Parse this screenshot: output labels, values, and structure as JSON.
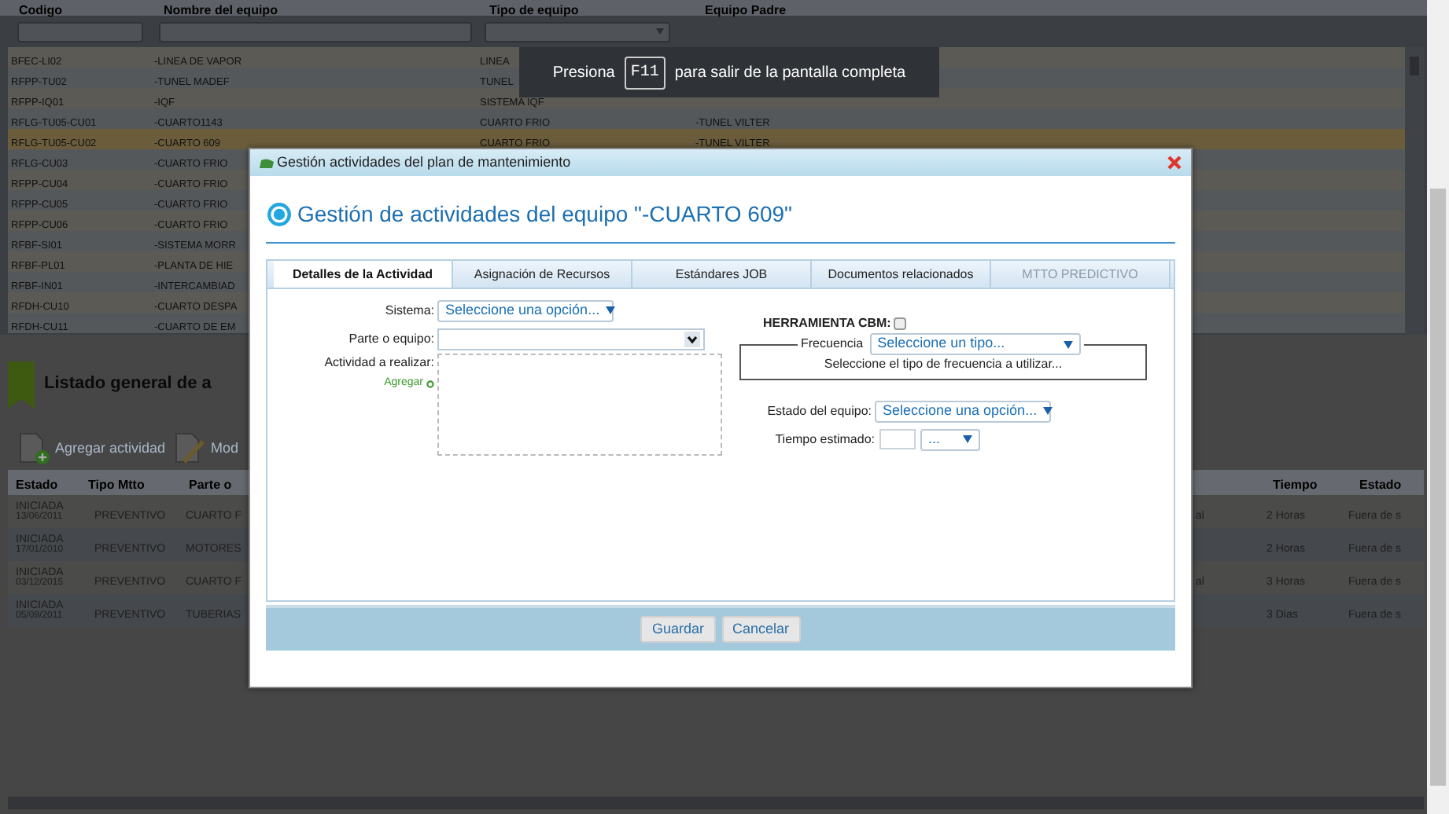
{
  "grid": {
    "columns": [
      "Codigo",
      "Nombre del equipo",
      "Tipo de equipo",
      "Equipo Padre"
    ],
    "rows": [
      {
        "cells": [
          "BFEC-LI02",
          "-LINEA DE VAPOR",
          "LINEA",
          ""
        ],
        "selected": false
      },
      {
        "cells": [
          "RFPP-TU02",
          "-TUNEL MADEF",
          "TUNEL",
          ""
        ],
        "selected": false
      },
      {
        "cells": [
          "RFPP-IQ01",
          "-IQF",
          "SISTEMA IQF",
          ""
        ],
        "selected": false
      },
      {
        "cells": [
          "RFLG-TU05-CU01",
          "-CUARTO1143",
          "CUARTO FRIO",
          "-TUNEL VILTER"
        ],
        "selected": false
      },
      {
        "cells": [
          "RFLG-TU05-CU02",
          "-CUARTO 609",
          "CUARTO FRIO",
          "-TUNEL VILTER"
        ],
        "selected": true
      },
      {
        "cells": [
          "RFLG-CU03",
          "-CUARTO FRIO",
          "",
          ""
        ],
        "selected": false
      },
      {
        "cells": [
          "RFPP-CU04",
          "-CUARTO FRIO",
          "",
          ""
        ],
        "selected": false
      },
      {
        "cells": [
          "RFPP-CU05",
          "-CUARTO FRIO",
          "",
          ""
        ],
        "selected": false
      },
      {
        "cells": [
          "RFPP-CU06",
          "-CUARTO FRIO",
          "",
          ""
        ],
        "selected": false
      },
      {
        "cells": [
          "RFBF-SI01",
          "-SISTEMA MORR",
          "",
          ""
        ],
        "selected": false
      },
      {
        "cells": [
          "RFBF-PL01",
          "-PLANTA DE HIE",
          "",
          ""
        ],
        "selected": false
      },
      {
        "cells": [
          "RFBF-IN01",
          "-INTERCAMBIAD",
          "",
          ""
        ],
        "selected": false
      },
      {
        "cells": [
          "RFDH-CU10",
          "-CUARTO DESPA",
          "",
          ""
        ],
        "selected": false
      },
      {
        "cells": [
          "RFDH-CU11",
          "-CUARTO DE EM",
          "",
          ""
        ],
        "selected": false
      }
    ]
  },
  "section_title": "Listado general de a",
  "toolbar": [
    {
      "kind": "add",
      "label": "Agregar actividad"
    },
    {
      "kind": "edit",
      "label": "Mod"
    }
  ],
  "activities": {
    "columns_left": [
      "Estado",
      "Tipo Mtto",
      "Parte o"
    ],
    "columns_right": [
      "Tiempo",
      "Estado"
    ],
    "rows": [
      {
        "status": "INICIADA",
        "date": "13/06/2011",
        "type": "PREVENTIVO",
        "part": "CUARTO F",
        "column_4": "al",
        "time": "2 Horas",
        "column_6": "Fuera de s"
      },
      {
        "status": "INICIADA",
        "date": "17/01/2010",
        "type": "PREVENTIVO",
        "part": "MOTORES",
        "column_4": "",
        "time": "2 Horas",
        "column_6": "Fuera de s"
      },
      {
        "status": "INICIADA",
        "date": "03/12/2015",
        "type": "PREVENTIVO",
        "part": "CUARTO F",
        "column_4": "al",
        "time": "3 Horas",
        "column_6": "Fuera de s"
      },
      {
        "status": "INICIADA",
        "date": "05/09/2011",
        "type": "PREVENTIVO",
        "part": "TUBERIAS",
        "column_4": "",
        "time": "3 Dias",
        "column_6": "Fuera de s"
      }
    ]
  },
  "fullscreen_toast": {
    "before": "Presiona",
    "key": "F11",
    "after": "para salir de la pantalla completa"
  },
  "dialog": {
    "title": "Gestión actividades del plan de mantenimiento",
    "heading": "Gestión de actividades del equipo \"-CUARTO 609\"",
    "tabs": [
      {
        "label": "Detalles de la Actividad",
        "selected": true,
        "disabled": false
      },
      {
        "label": "Asignación de Recursos",
        "selected": false,
        "disabled": false
      },
      {
        "label": "Estándares JOB",
        "selected": false,
        "disabled": false
      },
      {
        "label": "Documentos relacionados",
        "selected": false,
        "disabled": false
      },
      {
        "label": "MTTO PREDICTIVO",
        "selected": false,
        "disabled": true
      }
    ],
    "left_fields": [
      {
        "kind": "select",
        "label": "Sistema:",
        "value": "Seleccione una opción..."
      },
      {
        "kind": "combo",
        "label": "Parte o equipo:"
      },
      {
        "kind": "textarea",
        "label": "Actividad a realizar:",
        "link": "Agregar"
      }
    ],
    "cbm": {
      "label": "HERRAMIENTA CBM:",
      "checked": false
    },
    "frequency": {
      "legend": "Frecuencia",
      "value": "Seleccione un tipo...",
      "hint": "Seleccione el tipo de frecuencia a utilizar..."
    },
    "right_fields": [
      {
        "kind": "select",
        "label": "Estado del equipo:",
        "value": "Seleccione una opción..."
      },
      {
        "kind": "time",
        "label": "Tiempo estimado:",
        "unit": "..."
      }
    ],
    "buttons": [
      "Guardar",
      "Cancelar"
    ]
  }
}
